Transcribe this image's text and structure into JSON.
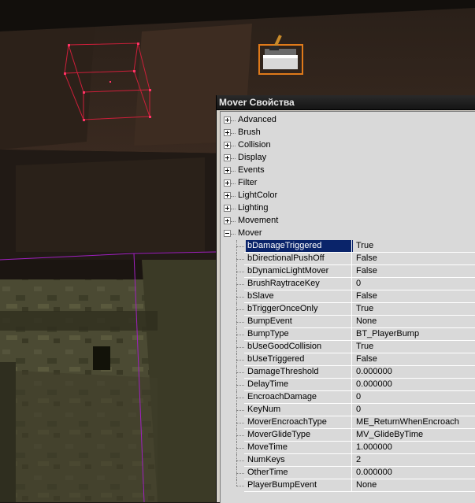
{
  "window": {
    "title": "Mover Свойства"
  },
  "categories": [
    {
      "label": "Advanced",
      "expanded": false
    },
    {
      "label": "Brush",
      "expanded": false
    },
    {
      "label": "Collision",
      "expanded": false
    },
    {
      "label": "Display",
      "expanded": false
    },
    {
      "label": "Events",
      "expanded": false
    },
    {
      "label": "Filter",
      "expanded": false
    },
    {
      "label": "LightColor",
      "expanded": false
    },
    {
      "label": "Lighting",
      "expanded": false
    },
    {
      "label": "Movement",
      "expanded": false
    },
    {
      "label": "Mover",
      "expanded": true
    }
  ],
  "mover_properties": [
    {
      "name": "bDamageTriggered",
      "value": "True",
      "selected": true
    },
    {
      "name": "bDirectionalPushOff",
      "value": "False"
    },
    {
      "name": "bDynamicLightMover",
      "value": "False"
    },
    {
      "name": "BrushRaytraceKey",
      "value": "0"
    },
    {
      "name": "bSlave",
      "value": "False"
    },
    {
      "name": "bTriggerOnceOnly",
      "value": "True"
    },
    {
      "name": "BumpEvent",
      "value": "None"
    },
    {
      "name": "BumpType",
      "value": "BT_PlayerBump"
    },
    {
      "name": "bUseGoodCollision",
      "value": "True"
    },
    {
      "name": "bUseTriggered",
      "value": "False"
    },
    {
      "name": "DamageThreshold",
      "value": "0.000000"
    },
    {
      "name": "DelayTime",
      "value": "0.000000"
    },
    {
      "name": "EncroachDamage",
      "value": "0"
    },
    {
      "name": "KeyNum",
      "value": "0"
    },
    {
      "name": "MoverEncroachType",
      "value": "ME_ReturnWhenEncroach"
    },
    {
      "name": "MoverGlideType",
      "value": "MV_GlideByTime"
    },
    {
      "name": "MoveTime",
      "value": "1.000000"
    },
    {
      "name": "NumKeys",
      "value": "2"
    },
    {
      "name": "OtherTime",
      "value": "0.000000"
    },
    {
      "name": "PlayerBumpEvent",
      "value": "None"
    }
  ],
  "colors": {
    "selection": "#0a246a",
    "brush_wire": "#cc1f3a",
    "mover_wire": "#a020c0",
    "grid_bg": "#d9d9d9"
  },
  "icons": {
    "trigger_actor": "trigger-icon",
    "expand": "plus-icon",
    "collapse": "minus-icon"
  }
}
